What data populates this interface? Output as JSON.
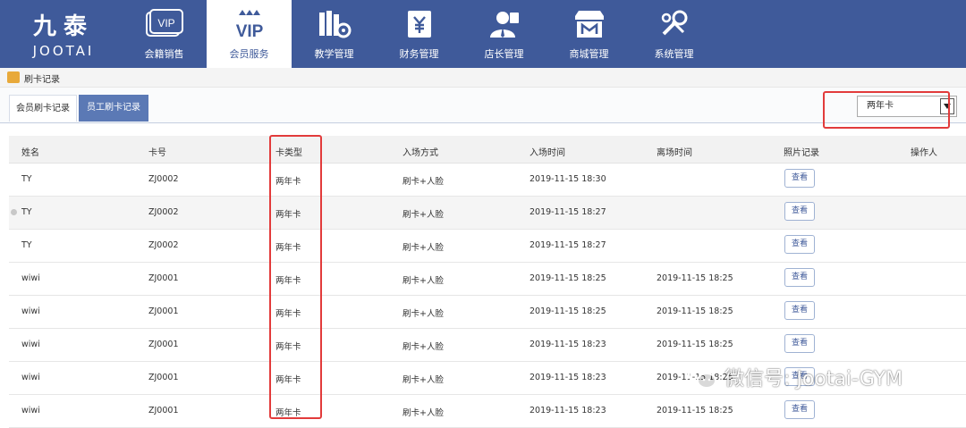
{
  "brand": {
    "cn": "九泰",
    "en": "JOOTAI"
  },
  "nav": [
    {
      "label": "会籍销售",
      "icon": "vip-card-icon"
    },
    {
      "label": "会员服务",
      "icon": "vip-crown-icon"
    },
    {
      "label": "教学管理",
      "icon": "books-gear-icon"
    },
    {
      "label": "财务管理",
      "icon": "yen-doc-icon"
    },
    {
      "label": "店长管理",
      "icon": "manager-icon"
    },
    {
      "label": "商城管理",
      "icon": "store-icon"
    },
    {
      "label": "系统管理",
      "icon": "settings-icon"
    }
  ],
  "nav_vip_text": "VIP",
  "breadcrumb": "刷卡记录",
  "tabs": {
    "member": "会员刷卡记录",
    "staff": "员工刷卡记录"
  },
  "filter": {
    "selected": "两年卡"
  },
  "columns": [
    "姓名",
    "卡号",
    "卡类型",
    "入场方式",
    "入场时间",
    "离场时间",
    "照片记录",
    "操作人"
  ],
  "rows": [
    {
      "name": "TY",
      "card": "ZJ0002",
      "type": "两年卡",
      "method": "刷卡+人脸",
      "in": "2019-11-15 18:30",
      "out": "",
      "btn": "查看"
    },
    {
      "name": "TY",
      "card": "ZJ0002",
      "type": "两年卡",
      "method": "刷卡+人脸",
      "in": "2019-11-15 18:27",
      "out": "",
      "btn": "查看"
    },
    {
      "name": "TY",
      "card": "ZJ0002",
      "type": "两年卡",
      "method": "刷卡+人脸",
      "in": "2019-11-15 18:27",
      "out": "",
      "btn": "查看"
    },
    {
      "name": "wiwi",
      "card": "ZJ0001",
      "type": "两年卡",
      "method": "刷卡+人脸",
      "in": "2019-11-15 18:25",
      "out": "2019-11-15 18:25",
      "btn": "查看"
    },
    {
      "name": "wiwi",
      "card": "ZJ0001",
      "type": "两年卡",
      "method": "刷卡+人脸",
      "in": "2019-11-15 18:25",
      "out": "2019-11-15 18:25",
      "btn": "查看"
    },
    {
      "name": "wiwi",
      "card": "ZJ0001",
      "type": "两年卡",
      "method": "刷卡+人脸",
      "in": "2019-11-15 18:23",
      "out": "2019-11-15 18:25",
      "btn": "查看"
    },
    {
      "name": "wiwi",
      "card": "ZJ0001",
      "type": "两年卡",
      "method": "刷卡+人脸",
      "in": "2019-11-15 18:23",
      "out": "2019-11-15 18:25",
      "btn": "查看"
    },
    {
      "name": "wiwi",
      "card": "ZJ0001",
      "type": "两年卡",
      "method": "刷卡+人脸",
      "in": "2019-11-15 18:23",
      "out": "2019-11-15 18:25",
      "btn": "查看"
    }
  ],
  "watermark": "微信号: Jootai-GYM",
  "colors": {
    "nav_bg": "#3f5a9a",
    "highlight": "#e23b3b",
    "tab_active": "#5b79b5"
  }
}
